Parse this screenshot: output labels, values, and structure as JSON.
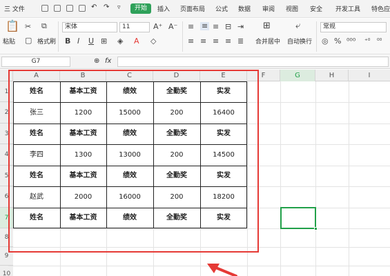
{
  "menubar": {
    "file": "三 文件",
    "start": "开始",
    "tabs": [
      "插入",
      "页面布局",
      "公式",
      "数据",
      "审阅",
      "视图",
      "安全",
      "开发工具",
      "特色应"
    ]
  },
  "ribbon": {
    "paste": "粘贴",
    "format_painter": "格式刷",
    "font_name": "宋体",
    "font_size": "11",
    "merge_center": "合并居中",
    "wrap_text": "自动换行",
    "number_format": "常规"
  },
  "formula": {
    "cell_ref": "G7",
    "fx": "fx"
  },
  "columns": [
    "A",
    "B",
    "C",
    "D",
    "E",
    "F",
    "G",
    "H",
    "I"
  ],
  "rows": [
    "1",
    "2",
    "3",
    "4",
    "5",
    "6",
    "7",
    "8",
    "9",
    "10"
  ],
  "table": [
    [
      "姓名",
      "基本工资",
      "绩效",
      "全勤奖",
      "实发"
    ],
    [
      "张三",
      "1200",
      "15000",
      "200",
      "16400"
    ],
    [
      "姓名",
      "基本工资",
      "绩效",
      "全勤奖",
      "实发"
    ],
    [
      "李四",
      "1300",
      "13000",
      "200",
      "14500"
    ],
    [
      "姓名",
      "基本工资",
      "绩效",
      "全勤奖",
      "实发"
    ],
    [
      "赵武",
      "2000",
      "16000",
      "200",
      "18200"
    ],
    [
      "姓名",
      "基本工资",
      "绩效",
      "全勤奖",
      "实发"
    ]
  ],
  "colors": {
    "accent": "#2fa15a",
    "highlight": "#e53935",
    "selection": "#21a049"
  }
}
